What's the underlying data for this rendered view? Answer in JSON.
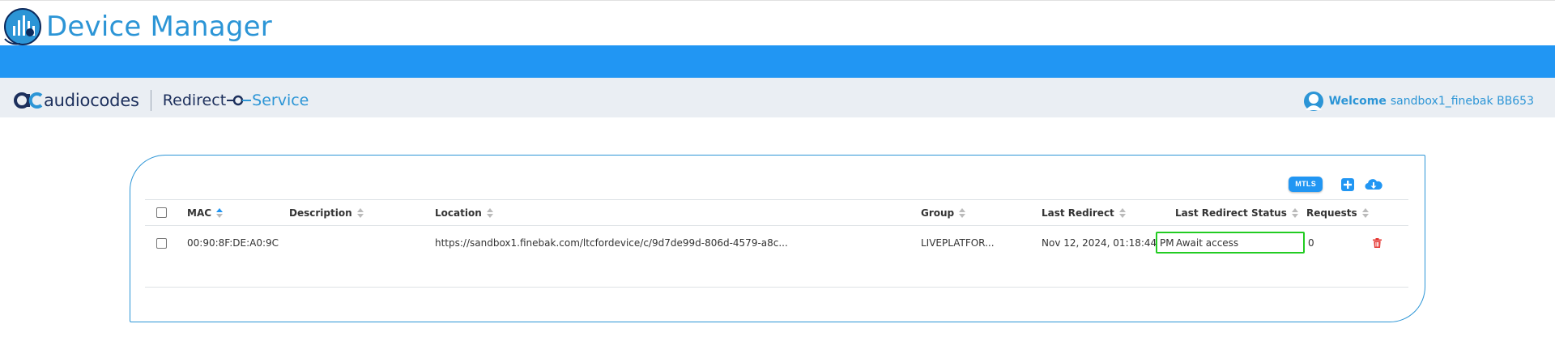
{
  "app": {
    "title": "Device Manager"
  },
  "brand": {
    "name": "audiocodes",
    "service_left": "Redirect",
    "service_right": "Service"
  },
  "user": {
    "welcome_label": "Welcome",
    "username": "sandbox1_finebak BB653"
  },
  "toolbar": {
    "mtls_label": "MTLS",
    "add_icon": "plus-square-icon",
    "download_icon": "cloud-download-icon"
  },
  "table": {
    "columns": [
      "MAC",
      "Description",
      "Location",
      "Group",
      "Last Redirect",
      "Last Redirect Status",
      "Requests"
    ],
    "sorted_column": "MAC",
    "rows": [
      {
        "mac": "00:90:8F:DE:A0:9C",
        "description": "",
        "location": "https://sandbox1.finebak.com/ltcfordevice/c/9d7de99d-806d-4579-a8c...",
        "group": "LIVEPLATFOR...",
        "last_redirect": "Nov 12, 2024, 01:18:44 PM",
        "last_redirect_status": "Await access",
        "requests": "0"
      }
    ]
  },
  "colors": {
    "accent": "#2196f3",
    "title_blue": "#2c95d6",
    "brand_navy": "#1c2f5c",
    "status_highlight": "#22cc22",
    "delete_red": "#e53935"
  }
}
